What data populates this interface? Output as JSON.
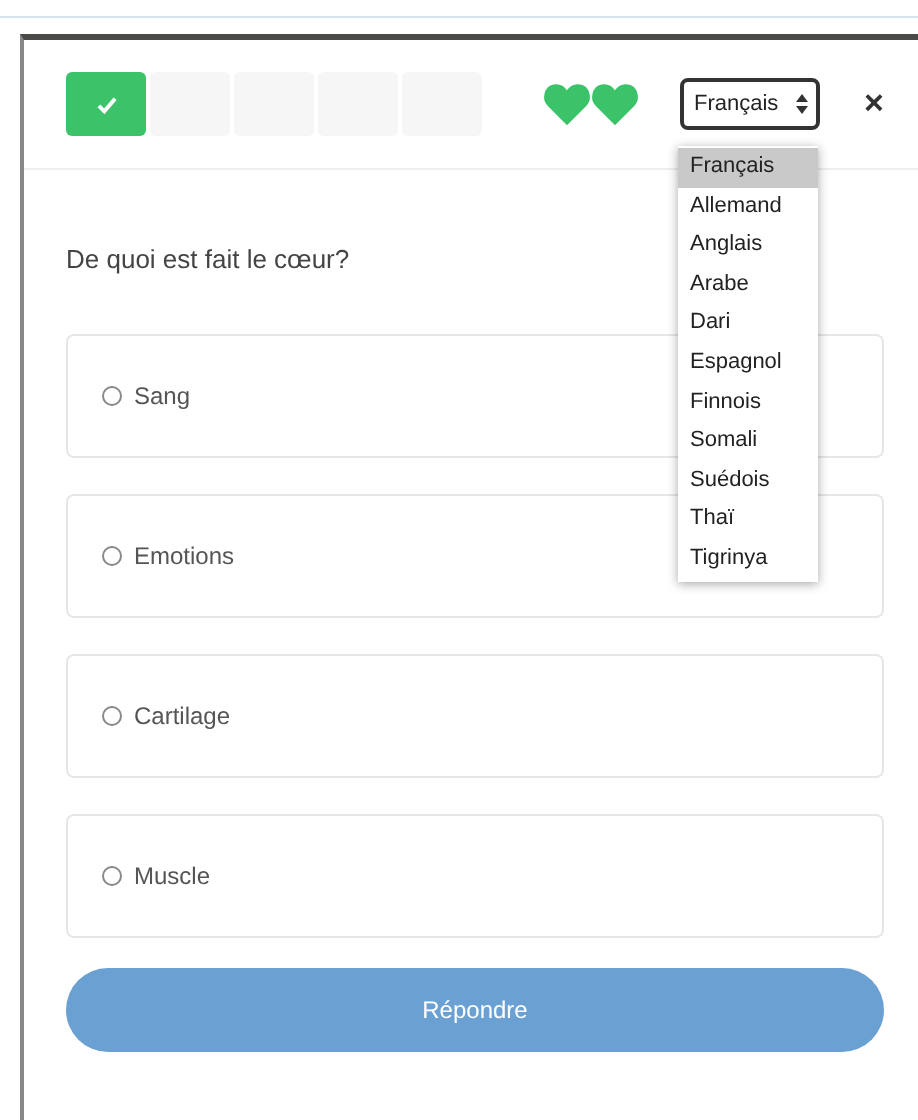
{
  "progress": [
    {
      "done": true
    },
    {
      "done": false
    },
    {
      "done": false
    },
    {
      "done": false
    },
    {
      "done": false
    }
  ],
  "hearts": [
    {
      "full": true
    },
    {
      "full": true
    }
  ],
  "language_select": {
    "value": "Français",
    "options": [
      {
        "label": "Français",
        "selected": true
      },
      {
        "label": "Allemand",
        "selected": false
      },
      {
        "label": "Anglais",
        "selected": false
      },
      {
        "label": "Arabe",
        "selected": false
      },
      {
        "label": "Dari",
        "selected": false
      },
      {
        "label": "Espagnol",
        "selected": false
      },
      {
        "label": "Finnois",
        "selected": false
      },
      {
        "label": "Somali",
        "selected": false
      },
      {
        "label": "Suédois",
        "selected": false
      },
      {
        "label": "Thaï",
        "selected": false
      },
      {
        "label": "Tigrinya",
        "selected": false
      }
    ]
  },
  "close": "×",
  "question": "De quoi est fait le cœur?",
  "answers": [
    {
      "label": "Sang",
      "selected": false
    },
    {
      "label": "Emotions",
      "selected": false
    },
    {
      "label": "Cartilage",
      "selected": false
    },
    {
      "label": "Muscle",
      "selected": false
    }
  ],
  "submit": "Répondre"
}
